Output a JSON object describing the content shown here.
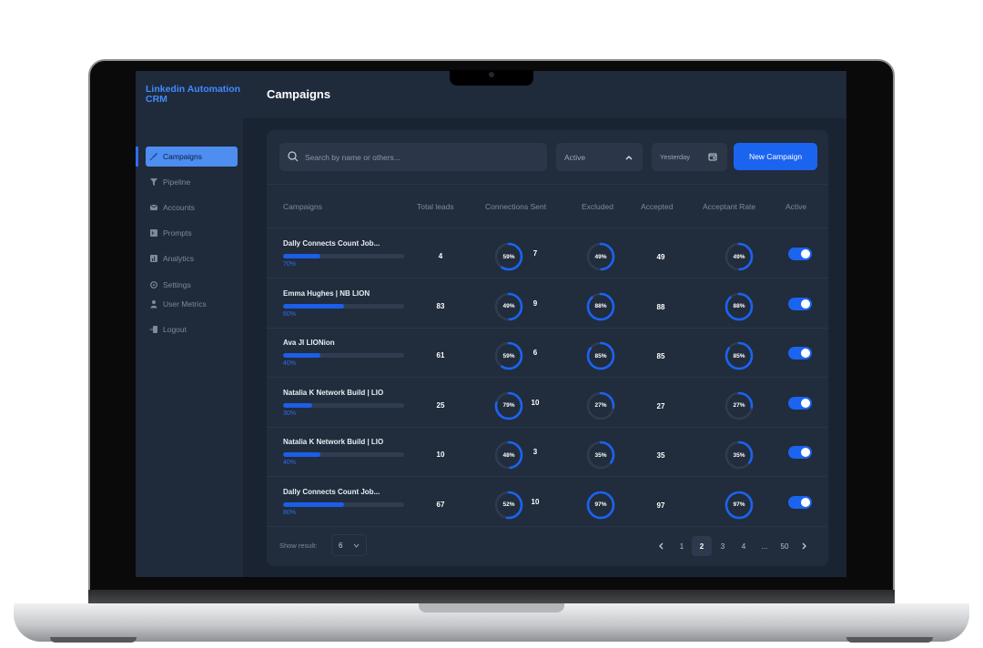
{
  "app": {
    "brand": "Linkedin Automation CRM",
    "page_title": "Campaigns"
  },
  "sidebar": {
    "items": [
      {
        "label": "Campaigns",
        "icon": "rocket-icon",
        "active": true
      },
      {
        "label": "Pipeline",
        "icon": "filter-icon",
        "active": false
      },
      {
        "label": "Accounts",
        "icon": "envelope-icon",
        "active": false
      },
      {
        "label": "Prompts",
        "icon": "terminal-icon",
        "active": false
      },
      {
        "label": "Analytics",
        "icon": "bar-chart-icon",
        "active": false
      },
      {
        "label": "Settings",
        "icon": "gear-icon",
        "active": false
      },
      {
        "label": "User Metrics",
        "icon": "user-icon",
        "active": false
      },
      {
        "label": "Logout",
        "icon": "logout-icon",
        "active": false
      }
    ]
  },
  "toolbar": {
    "search_placeholder": "Search by name or others...",
    "status_value": "Active",
    "date_value": "Yesterday",
    "new_button": "New Campaign"
  },
  "table": {
    "columns": [
      "Campaigns",
      "Total leads",
      "Connections Sent",
      "Excluded",
      "Accepted",
      "Acceptant Rate",
      "Active"
    ],
    "rows": [
      {
        "name": "Dally Connects Count Job...",
        "progress": "70%",
        "progress_value": 0.31,
        "total_leads": "4",
        "conn_pct": "59%",
        "conn_value": 0.59,
        "conn_sent": "7",
        "excluded": "49%",
        "excluded_value": 0.49,
        "accepted": "49",
        "rate": "49%",
        "rate_value": 0.49,
        "active": true
      },
      {
        "name": "Emma Hughes | NB LION",
        "progress": "60%",
        "progress_value": 0.5,
        "total_leads": "83",
        "conn_pct": "49%",
        "conn_value": 0.49,
        "conn_sent": "9",
        "excluded": "88%",
        "excluded_value": 0.88,
        "accepted": "88",
        "rate": "88%",
        "rate_value": 0.88,
        "active": true
      },
      {
        "name": "Ava JI LIONion",
        "progress": "40%",
        "progress_value": 0.31,
        "total_leads": "61",
        "conn_pct": "59%",
        "conn_value": 0.59,
        "conn_sent": "6",
        "excluded": "85%",
        "excluded_value": 0.85,
        "accepted": "85",
        "rate": "85%",
        "rate_value": 0.85,
        "active": true
      },
      {
        "name": "Natalia K Network Build | LIO",
        "progress": "30%",
        "progress_value": 0.24,
        "total_leads": "25",
        "conn_pct": "79%",
        "conn_value": 0.79,
        "conn_sent": "10",
        "excluded": "27%",
        "excluded_value": 0.27,
        "accepted": "27",
        "rate": "27%",
        "rate_value": 0.27,
        "active": true
      },
      {
        "name": "Natalia K Network Build | LIO",
        "progress": "40%",
        "progress_value": 0.31,
        "total_leads": "10",
        "conn_pct": "48%",
        "conn_value": 0.48,
        "conn_sent": "3",
        "excluded": "35%",
        "excluded_value": 0.35,
        "accepted": "35",
        "rate": "35%",
        "rate_value": 0.35,
        "active": true
      },
      {
        "name": "Dally Connects Count Job...",
        "progress": "80%",
        "progress_value": 0.5,
        "total_leads": "67",
        "conn_pct": "52%",
        "conn_value": 0.52,
        "conn_sent": "10",
        "excluded": "97%",
        "excluded_value": 0.97,
        "accepted": "97",
        "rate": "97%",
        "rate_value": 0.97,
        "active": true
      }
    ]
  },
  "footer": {
    "show_label": "Show result:",
    "show_value": "6",
    "pages": [
      "1",
      "2",
      "3",
      "4",
      "...",
      "50"
    ],
    "current_page": "2"
  },
  "colors": {
    "accent": "#1a64f0",
    "ring_track": "#2f3b4f",
    "background": "#1a2332"
  }
}
